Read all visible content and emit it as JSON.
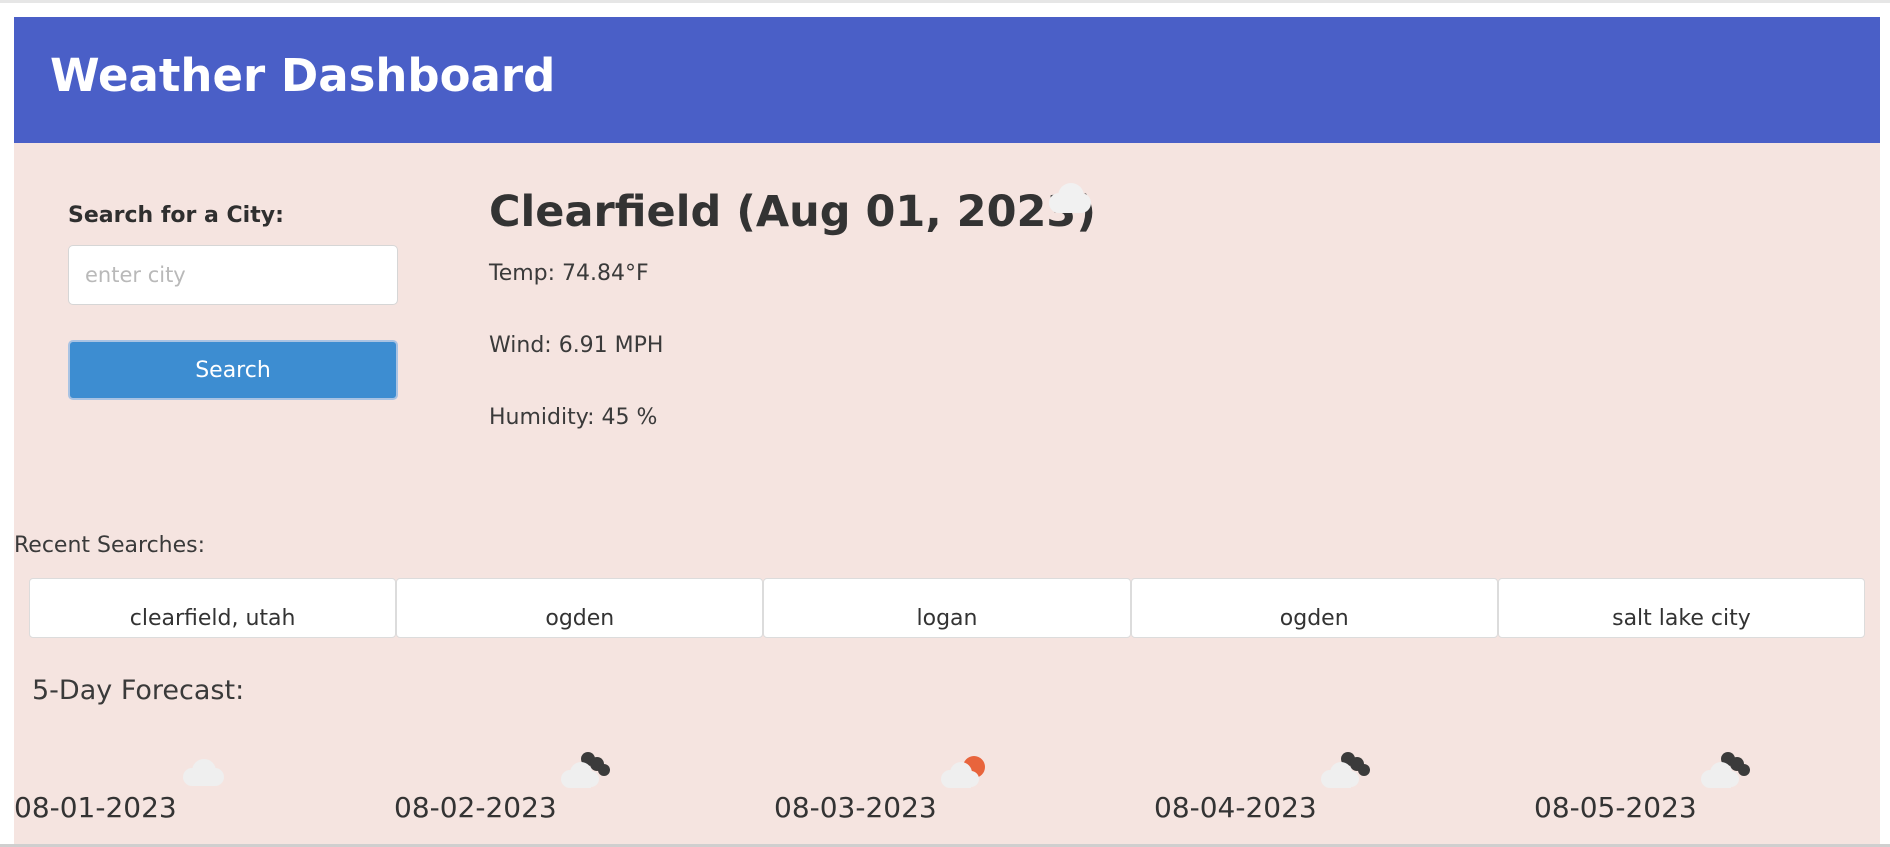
{
  "app": {
    "title": "Weather Dashboard"
  },
  "search": {
    "label": "Search for a City:",
    "placeholder": "enter city",
    "value": "",
    "button_label": "Search"
  },
  "current": {
    "title": "Clearfield (Aug 01, 2023)",
    "icon": "cloud-icon",
    "temp": "Temp: 74.84°F",
    "wind": "Wind: 6.91 MPH",
    "humidity": "Humidity: 45 %"
  },
  "recent": {
    "label": "Recent Searches:",
    "items": [
      "clearfield, utah",
      "ogden",
      "logan",
      "ogden",
      "salt lake city"
    ]
  },
  "forecast": {
    "label": "5-Day Forecast:",
    "days": [
      {
        "date": "08-01-2023",
        "icon": "cloud-icon"
      },
      {
        "date": "08-02-2023",
        "icon": "cloud-night-icon"
      },
      {
        "date": "08-03-2023",
        "icon": "cloud-sun-icon"
      },
      {
        "date": "08-04-2023",
        "icon": "cloud-night-icon"
      },
      {
        "date": "08-05-2023",
        "icon": "cloud-night-icon"
      }
    ]
  },
  "colors": {
    "header": "#4a5fc7",
    "background": "#f5e4e0",
    "search_button": "#3d8dd1",
    "sun": "#e8643c",
    "night_cloud": "#3b3b3b",
    "light_cloud": "#eeeeee"
  }
}
